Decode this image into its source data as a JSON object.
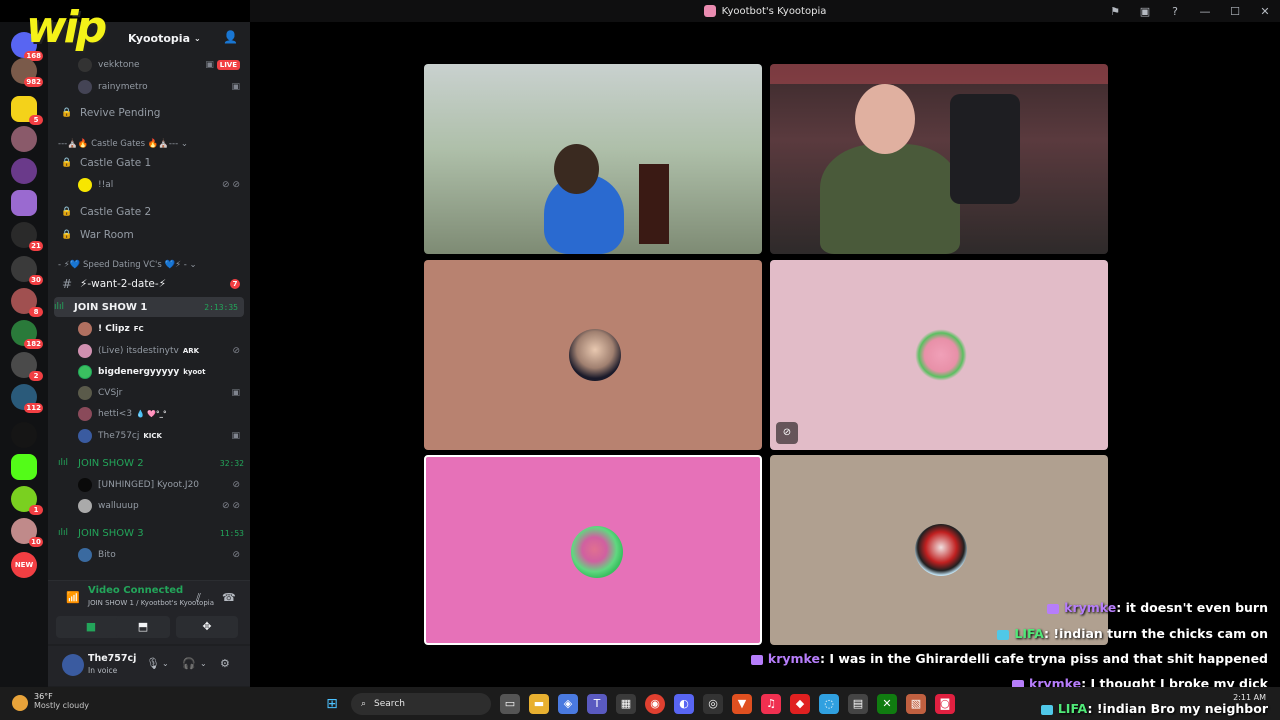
{
  "window": {
    "title": "Kyootbot's Kyootopia",
    "controls": [
      "flag-icon",
      "overlay-icon",
      "help-icon",
      "minimize",
      "maximize",
      "close"
    ]
  },
  "overlay_logo": "WIP",
  "server_rail": {
    "badges": [
      "168",
      "982",
      "5",
      "21",
      "30",
      "8",
      "182",
      "2",
      "112",
      "1",
      "10"
    ],
    "new_label": "NEW"
  },
  "server": {
    "name": "Kyootopia"
  },
  "sidebar": {
    "top_users": [
      {
        "name": "vekktone",
        "live": "LIVE"
      },
      {
        "name": "rainymetro"
      }
    ],
    "revive": "Revive Pending",
    "castle_category": "Castle Gates",
    "castle_gate_1": "Castle Gate 1",
    "gate1_user": "!!al",
    "castle_gate_2": "Castle Gate 2",
    "war_room": "War Room",
    "speed_category": "Speed Dating VC's",
    "text_channel": "-want-2-date-",
    "text_mentions": "7",
    "join_show_1": {
      "name": "JOIN SHOW 1",
      "timer": "2:13:35"
    },
    "show1_users": [
      {
        "name": "! Clipz",
        "tag": "FC"
      },
      {
        "name": "(Live) itsdestinytv",
        "tag": "ARK"
      },
      {
        "name": "bigdenergyyyyy",
        "tag": "kyoot"
      },
      {
        "name": "CVSjr",
        "tag": ""
      },
      {
        "name": "hetti<3",
        "tag": ""
      },
      {
        "name": "The757cj",
        "tag": "KICK"
      }
    ],
    "join_show_2": {
      "name": "JOIN SHOW 2",
      "timer": "32:32"
    },
    "show2_users": [
      {
        "name": "[UNHINGED] Kyoot.J20"
      },
      {
        "name": "walluuup"
      }
    ],
    "join_show_3": {
      "name": "JOIN SHOW 3",
      "timer": "11:53"
    },
    "show3_users": [
      {
        "name": "Bito"
      }
    ]
  },
  "voice_panel": {
    "status": "Video Connected",
    "location": "JOIN SHOW 1 / Kyootbot's Kyootopia"
  },
  "user_panel": {
    "username": "The757cj",
    "status": "In voice"
  },
  "chat": [
    {
      "user": "krymke",
      "text": ": it doesn't even burn"
    },
    {
      "user": "LIFA",
      "text": ": !indian turn the chicks cam on"
    },
    {
      "user": "krymke",
      "text": ": I was in the Ghirardelli cafe tryna piss and that shit happened"
    },
    {
      "user": "krymke",
      "text": ": I thought I broke my dick"
    },
    {
      "user": "LIFA",
      "text": ": !indian Bro my neighbor"
    }
  ],
  "taskbar": {
    "temp": "36°F",
    "weather": "Mostly cloudy",
    "search_placeholder": "Search",
    "time": "2:11 AM"
  },
  "colors": {
    "tile_tan": "#b88270",
    "tile_pink_light": "#e2bcc8",
    "tile_pink": "#e671b8",
    "tile_taupe": "#b0a090",
    "voice_green": "#23a55a",
    "chat_purple": "#b67dfa",
    "chat_green": "#50e878"
  }
}
